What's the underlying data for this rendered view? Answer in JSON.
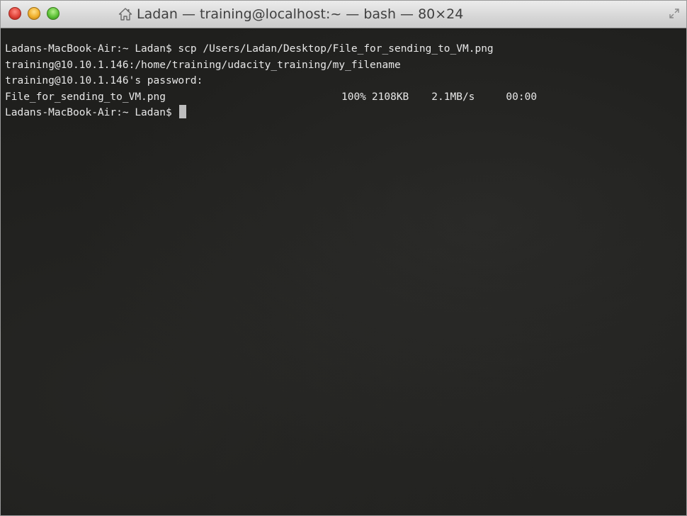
{
  "window": {
    "title": "Ladan — training@localhost:~ — bash — 80×24",
    "traffic_lights": [
      "close",
      "minimize",
      "zoom"
    ],
    "title_icon": "home-icon"
  },
  "terminal": {
    "line1": "Ladans-MacBook-Air:~ Ladan$ scp /Users/Ladan/Desktop/File_for_sending_to_VM.png",
    "line2": "training@10.10.1.146:/home/training/udacity_training/my_filename",
    "line3": "training@10.10.1.146's password:",
    "transfer": {
      "filename": "File_for_sending_to_VM.png",
      "percent": "100%",
      "size": "2108KB",
      "rate": "2.1MB/s",
      "eta": "00:00"
    },
    "prompt": "Ladans-MacBook-Air:~ Ladan$"
  },
  "colors": {
    "terminal_bg": "#1f1f1d",
    "terminal_text": "#e8e8e8",
    "close": "#e0443a",
    "minimize": "#f0b02c",
    "zoom": "#5dc237"
  }
}
